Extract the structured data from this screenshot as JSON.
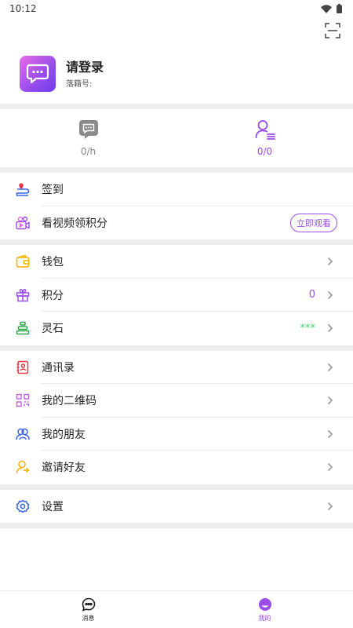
{
  "status_bar": {
    "time": "10:12"
  },
  "profile": {
    "name": "请登录",
    "id_label": "落籍号:"
  },
  "stats": [
    {
      "value": "0/h",
      "color": "#888888"
    },
    {
      "value": "0/0",
      "color": "#9b4dea"
    }
  ],
  "menu": {
    "checkin": "签到",
    "video_points": "看视频领积分",
    "watch_now": "立即观看",
    "wallet": "钱包",
    "points": "积分",
    "points_value": "0",
    "spirit_stone": "灵石",
    "spirit_stone_value": "***",
    "contacts": "通讯录",
    "qrcode": "我的二维码",
    "friends": "我的朋友",
    "invite": "邀请好友",
    "settings": "设置"
  },
  "bottom_nav": {
    "messages": "消息",
    "mine": "我的"
  },
  "colors": {
    "accent": "#9b4dea",
    "green": "#4cd06f",
    "gray": "#888888"
  }
}
